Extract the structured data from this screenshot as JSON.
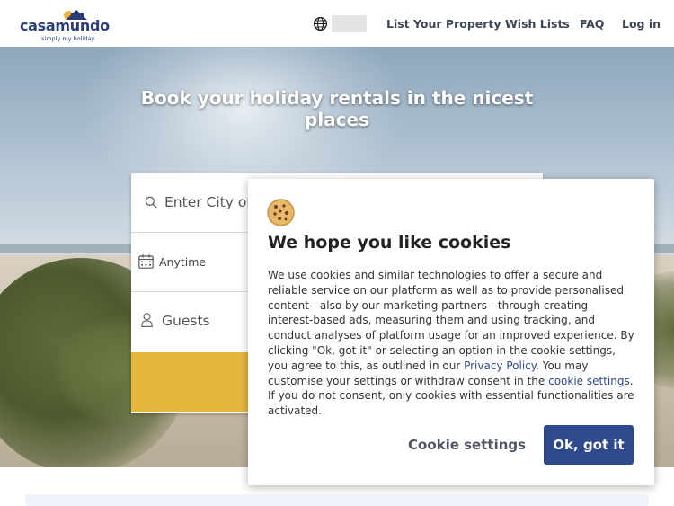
{
  "header": {
    "logo": {
      "brand": "casamundo",
      "tagline": "simply my holiday"
    },
    "nav": {
      "globe_icon": "globe-icon",
      "list_property": "List Your Property",
      "wish_lists": "Wish Lists",
      "faq": "FAQ",
      "login": "Log in"
    }
  },
  "hero": {
    "title": "Book your holiday rentals in the nicest places"
  },
  "search": {
    "destination_placeholder": "Enter City or",
    "dates": "Anytime",
    "guests": "Guests",
    "icons": {
      "search": "search-icon",
      "calendar": "calendar-icon",
      "guests": "person-icon"
    }
  },
  "cookie_dialog": {
    "icon": "cookie-icon",
    "title": "We hope you like cookies",
    "body_part1": "We use cookies and similar technologies to offer a secure and reliable service on our platform as well as to provide personalised content - also by our marketing partners - through creating interest-based ads, measuring them and using tracking, and conduct analyses of platform usage for an improved experience. By clicking \"Ok, got it\" or selecting an option in the cookie settings, you agree to this, as outlined in our ",
    "privacy_link": "Privacy Policy",
    "body_part2": ". You may customise your settings or withdraw consent in the ",
    "settings_link": "cookie settings",
    "body_part3": ". If you do not consent, only cookies with essential functionalities are activated.",
    "settings_button": "Cookie settings",
    "ok_button": "Ok, got it"
  },
  "colors": {
    "brand_navy": "#2b3d78",
    "ok_button": "#2f4a8a",
    "search_button": "#e7b63f",
    "link": "#2c4a8c"
  }
}
